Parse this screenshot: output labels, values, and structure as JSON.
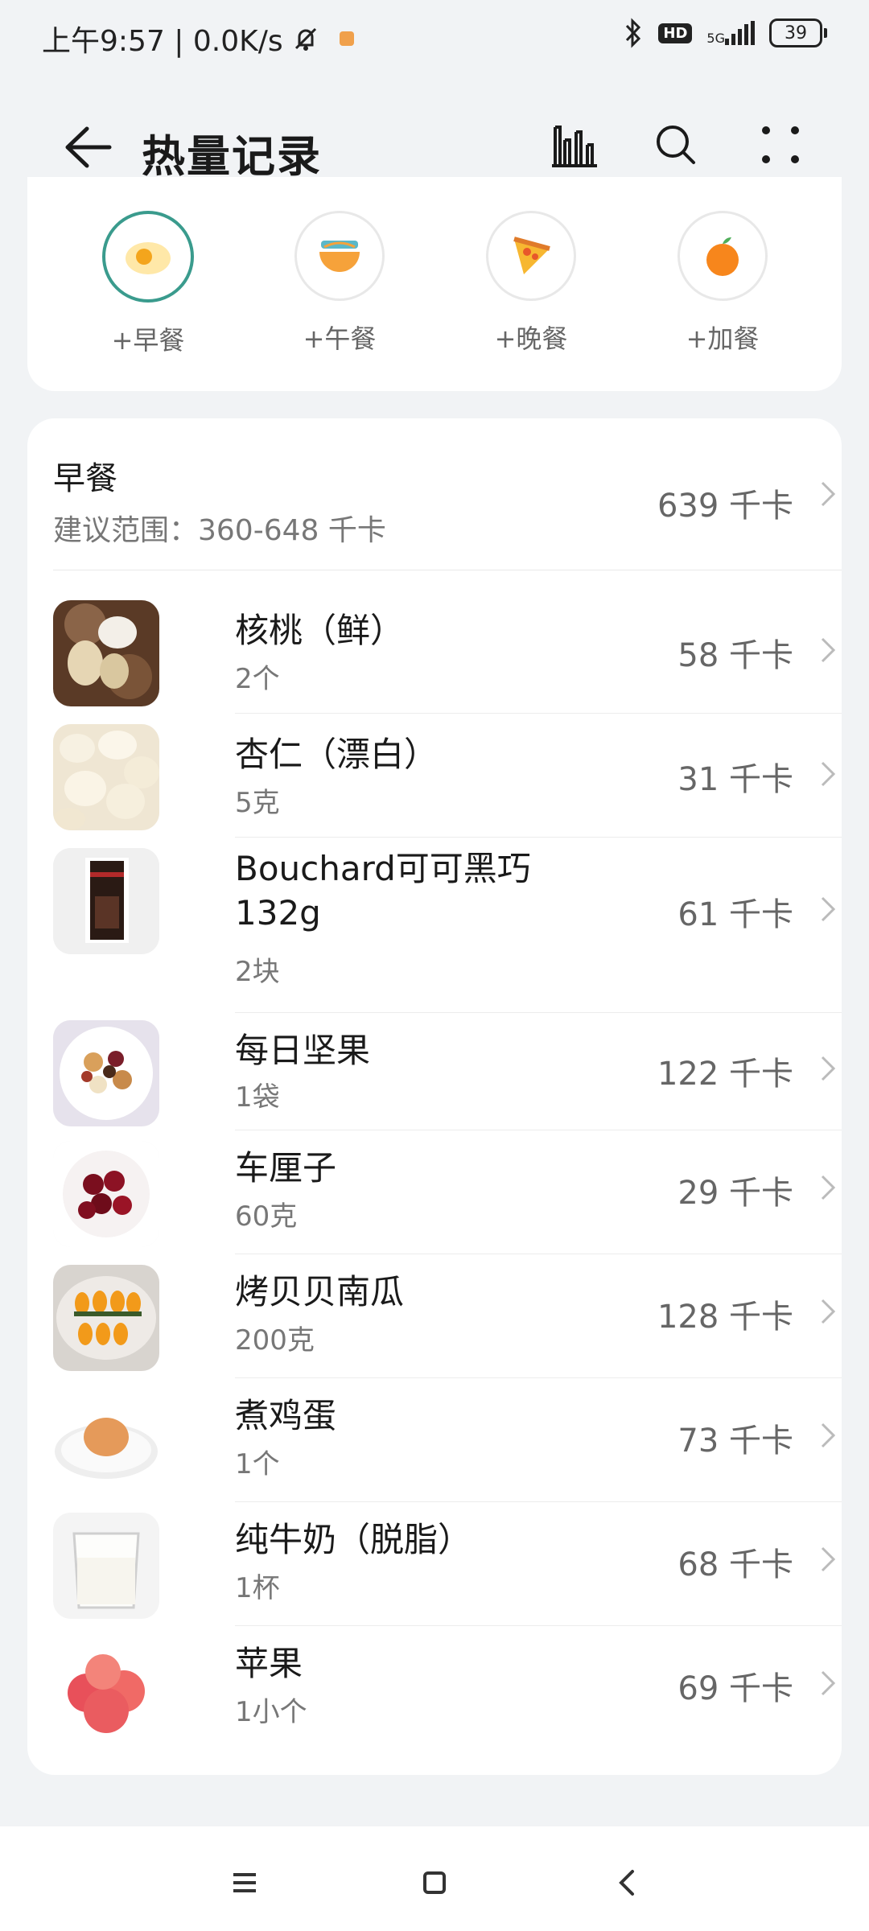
{
  "status_bar": {
    "time_net": "上午9:57 | 0.0K/s",
    "hd": "HD",
    "network": "5G",
    "battery": "39"
  },
  "header": {
    "title": "热量记录"
  },
  "meal_buttons": [
    {
      "label": "+早餐",
      "icon": "egg-icon",
      "selected": true
    },
    {
      "label": "+午餐",
      "icon": "noodle-bowl-icon",
      "selected": false
    },
    {
      "label": "+晚餐",
      "icon": "pizza-icon",
      "selected": false
    },
    {
      "label": "+加餐",
      "icon": "orange-icon",
      "selected": false
    }
  ],
  "breakfast": {
    "title": "早餐",
    "range": "建议范围：360-648 千卡",
    "total": "639 千卡",
    "items": [
      {
        "name": "核桃（鲜）",
        "qty": "2个",
        "kcal": "58 千卡",
        "thumb": "walnut"
      },
      {
        "name": "杏仁（漂白）",
        "qty": "5克",
        "kcal": "31 千卡",
        "thumb": "almond"
      },
      {
        "name": "Bouchard可可黑巧",
        "name2": "132g",
        "qty": "2块",
        "kcal": "61 千卡",
        "thumb": "chocolate"
      },
      {
        "name": "每日坚果",
        "qty": "1袋",
        "kcal": "122 千卡",
        "thumb": "nuts"
      },
      {
        "name": "车厘子",
        "qty": "60克",
        "kcal": "29 千卡",
        "thumb": "cherry"
      },
      {
        "name": "烤贝贝南瓜",
        "qty": "200克",
        "kcal": "128 千卡",
        "thumb": "pumpkin"
      },
      {
        "name": "煮鸡蛋",
        "qty": "1个",
        "kcal": "73 千卡",
        "thumb": "egg"
      },
      {
        "name": "纯牛奶（脱脂）",
        "qty": "1杯",
        "kcal": "68 千卡",
        "thumb": "milk"
      },
      {
        "name": "苹果",
        "qty": "1小个",
        "kcal": "69 千卡",
        "thumb": "apple"
      }
    ]
  },
  "colors": {
    "accent": "#3a9b8d",
    "background": "#f1f3f5",
    "card": "#ffffff",
    "text_secondary": "#777777"
  }
}
